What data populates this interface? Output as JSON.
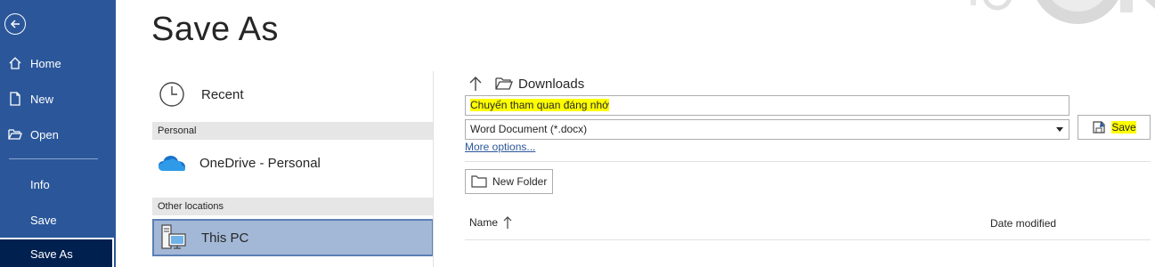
{
  "sidebar": {
    "items": [
      {
        "label": "Home",
        "icon": "home-icon"
      },
      {
        "label": "New",
        "icon": "new-document-icon"
      },
      {
        "label": "Open",
        "icon": "open-folder-icon"
      },
      {
        "label": "Info"
      },
      {
        "label": "Save"
      },
      {
        "label": "Save As"
      }
    ],
    "active": "Save As"
  },
  "page": {
    "title": "Save As"
  },
  "locations": {
    "recent": "Recent",
    "personal_header": "Personal",
    "onedrive": "OneDrive - Personal",
    "other_header": "Other locations",
    "this_pc": "This PC"
  },
  "pane": {
    "current_folder": "Downloads",
    "filename": "Chuyến tham quan đáng nhớ",
    "filetype": "Word Document (*.docx)",
    "more_options": "More options...",
    "save_label": "Save",
    "new_folder_label": "New Folder",
    "columns": {
      "name": "Name",
      "date_modified": "Date modified"
    }
  },
  "colors": {
    "sidebar": "#2b579a",
    "active_item": "#002050",
    "highlight": "#ffff00",
    "selected_location": "#a3b8d6"
  }
}
